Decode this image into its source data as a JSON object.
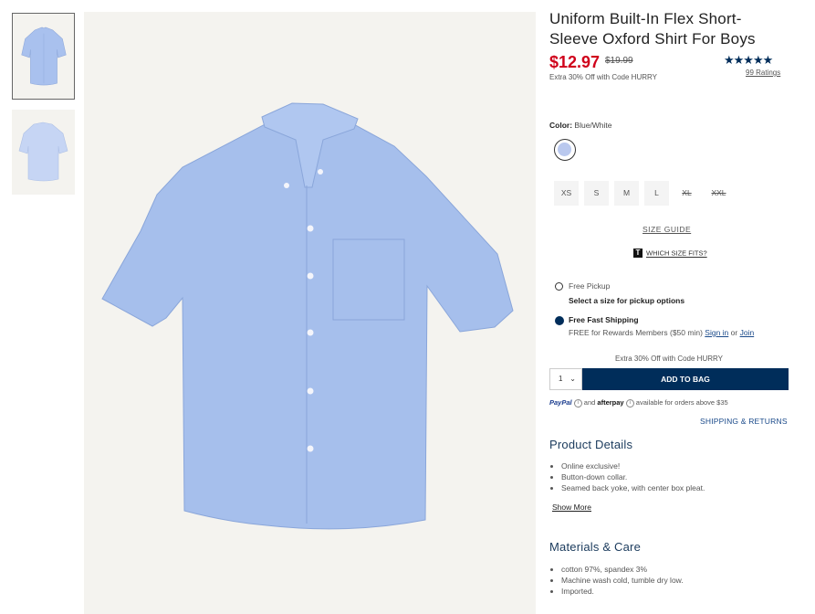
{
  "product": {
    "title": "Uniform Built-In Flex Short-Sleeve Oxford Shirt For Boys",
    "price": "$12.97",
    "original_price": "$19.99",
    "promo": "Extra 30% Off with Code HURRY",
    "stars": "★★★★★",
    "ratings": "99 Ratings"
  },
  "color": {
    "label": "Color:",
    "value": "Blue/White",
    "swatch": "#b9c8ee"
  },
  "sizes": [
    {
      "label": "XS",
      "available": true
    },
    {
      "label": "S",
      "available": true
    },
    {
      "label": "M",
      "available": true
    },
    {
      "label": "L",
      "available": true
    },
    {
      "label": "XL",
      "available": false
    },
    {
      "label": "XXL",
      "available": false
    }
  ],
  "size_guide": "SIZE GUIDE",
  "which_size": {
    "icon": "T",
    "text": "WHICH SIZE FITS?"
  },
  "fulfillment": {
    "pickup_label": "Free Pickup",
    "pickup_note": "Select a size for pickup options",
    "shipping_label": "Free Fast Shipping",
    "shipping_note": "FREE for Rewards Members ($50 min)",
    "sign_in": "Sign in",
    "or": "or",
    "join": "Join"
  },
  "cart": {
    "promo": "Extra 30% Off with Code HURRY",
    "qty": "1",
    "add_to_bag": "ADD TO BAG"
  },
  "payment": {
    "paypal": "PayPal",
    "and": "and",
    "afterpay": "afterpay",
    "note": "available for orders above $35"
  },
  "shipping_returns": "SHIPPING & RETURNS",
  "details": {
    "heading": "Product Details",
    "items": [
      "Online exclusive!",
      "Button-down collar.",
      "Seamed back yoke, with center box pleat."
    ],
    "show_more": "Show More"
  },
  "materials": {
    "heading": "Materials & Care",
    "items": [
      "cotton 97%, spandex 3%",
      "Machine wash cold, tumble dry low.",
      "Imported."
    ]
  },
  "colors": {
    "accent": "#002d5a",
    "sale": "#d0021b",
    "shirt": "#a6bfec"
  }
}
